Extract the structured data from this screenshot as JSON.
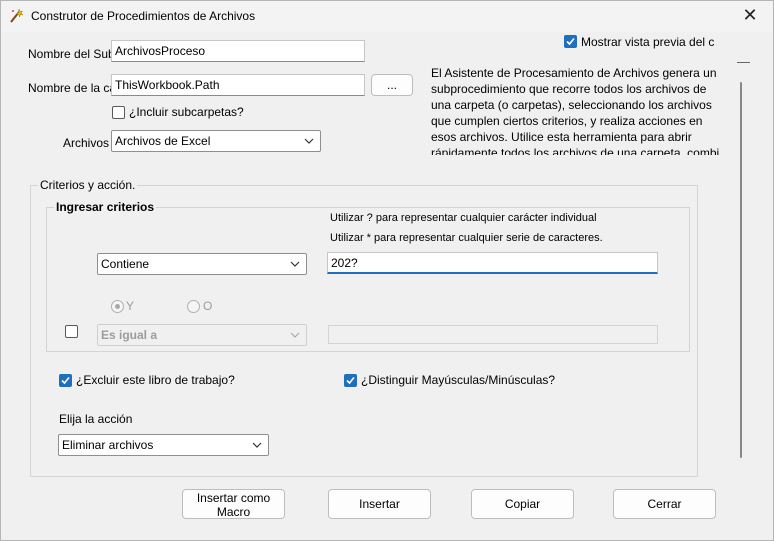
{
  "window": {
    "title": "Construtor de Procedimientos de Archivos",
    "close_symbol": "✕"
  },
  "form": {
    "subproc_label": "Nombre del Sub",
    "subproc_value": "ArchivosProceso",
    "folder_label": "Nombre de la ca",
    "folder_value": "ThisWorkbook.Path",
    "browse_label": "...",
    "include_subfolders_label": "¿Incluir subcarpetas?",
    "include_subfolders_checked": false,
    "files_label": "Archivos",
    "files_value": "Archivos de Excel"
  },
  "preview": {
    "show_preview_label": "Mostrar vista previa del c",
    "show_preview_checked": true,
    "description": "El Asistente de Procesamiento de Archivos genera un subprocedimiento que recorre todos los archivos de una carpeta (o carpetas), seleccionando los archivos que cumplen ciertos criterios, y realiza acciones en esos archivos. Utilice esta herramienta para abrir rápidamente todos los archivos de una carpeta, combi"
  },
  "criteria": {
    "group_title": "Criterios y acción.",
    "enter_title": "Ingresar criterios",
    "hint1": "Utilizar ? para representar cualquier carácter individual",
    "hint2": "Utilizar * para representar cualquier serie de caracteres.",
    "condition1_value": "Contiene",
    "criteria1_value": "202?",
    "radio_and_label": "Y",
    "radio_or_label": "O",
    "condition2_value": "Es igual a",
    "criteria2_value": "",
    "row2_checked": false,
    "exclude_workbook_label": "¿Excluir este libro de trabajo?",
    "exclude_workbook_checked": true,
    "case_sensitive_label": "¿Distinguir Mayúsculas/Minúsculas?",
    "case_sensitive_checked": true,
    "action_label": "Elija la acción",
    "action_value": "Eliminar archivos"
  },
  "buttons": {
    "insert_macro": "Insertar como Macro",
    "insert": "Insertar",
    "copy": "Copiar",
    "close": "Cerrar"
  },
  "colors": {
    "accent": "#1f6fbf",
    "background": "#f0f0f0"
  }
}
